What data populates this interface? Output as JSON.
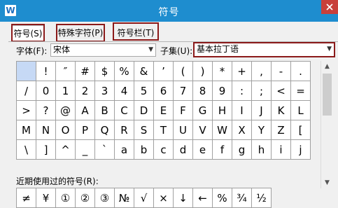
{
  "window": {
    "title": "符号",
    "app_icon": "W",
    "close_icon": "close-icon"
  },
  "tabs": [
    {
      "label": "符号(S)"
    },
    {
      "label": "特殊字符(P)"
    },
    {
      "label": "符号栏(T)"
    }
  ],
  "font": {
    "label": "字体(F):",
    "value": "宋体"
  },
  "subset": {
    "label": "子集(U):",
    "value": "基本拉丁语"
  },
  "symbol_grid": [
    [
      "",
      "!",
      "″",
      "#",
      "$",
      "%",
      "&",
      "’",
      "(",
      ")",
      "*",
      "+",
      ",",
      "-",
      "."
    ],
    [
      "/",
      "0",
      "1",
      "2",
      "3",
      "4",
      "5",
      "6",
      "7",
      "8",
      "9",
      ":",
      ";",
      "<",
      "="
    ],
    [
      ">",
      "?",
      "@",
      "A",
      "B",
      "C",
      "D",
      "E",
      "F",
      "G",
      "H",
      "I",
      "J",
      "K",
      "L"
    ],
    [
      "M",
      "N",
      "O",
      "P",
      "Q",
      "R",
      "S",
      "T",
      "U",
      "V",
      "W",
      "X",
      "Y",
      "Z",
      "["
    ],
    [
      "\\",
      "]",
      "^",
      "_",
      "`",
      "a",
      "b",
      "c",
      "d",
      "e",
      "f",
      "g",
      "h",
      "i",
      "j"
    ]
  ],
  "recent": {
    "label": "近期使用过的符号(R):",
    "symbols": [
      "≠",
      "¥",
      "①",
      "②",
      "③",
      "№",
      "√",
      "×",
      "↓",
      "←",
      "%",
      "¾",
      "½"
    ]
  },
  "colors": {
    "titlebar": "#1e8dcf",
    "highlight_box": "#8b1a1a",
    "selected_cell": "#c6d9f5"
  }
}
